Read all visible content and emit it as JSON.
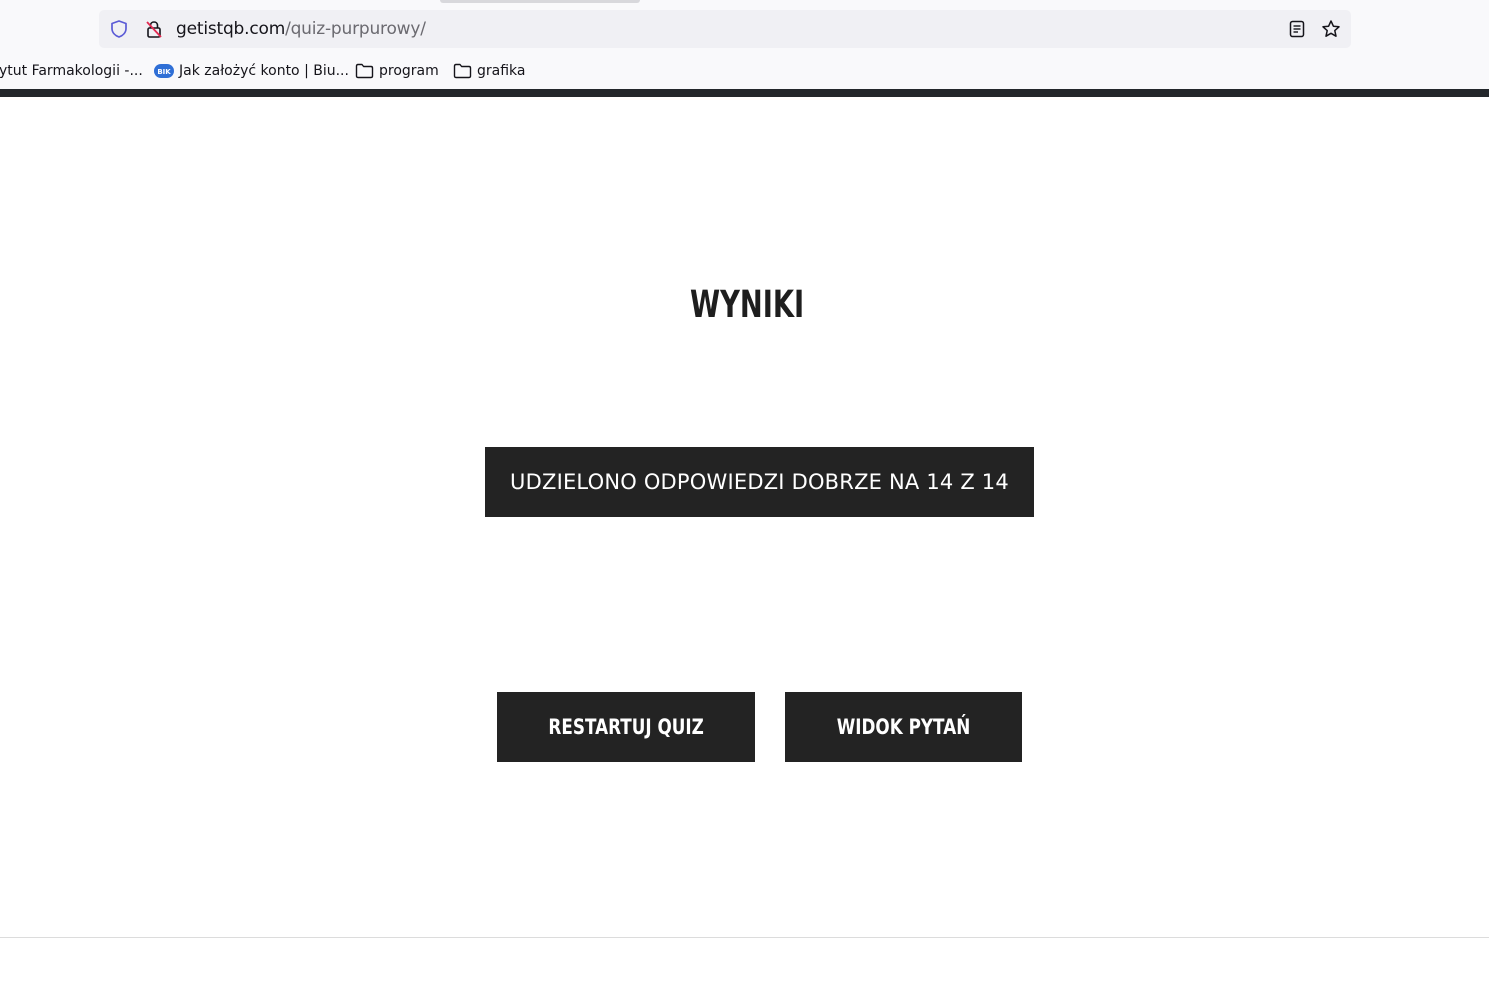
{
  "browser": {
    "url_domain": "getistqb.com",
    "url_path": "/quiz-purpurowy/",
    "bookmarks": [
      {
        "label": "ytut Farmakologii -...",
        "icon": "none"
      },
      {
        "label": "Jak założyć konto | Biu...",
        "icon": "bik-logo-icon",
        "icon_text": "BIK"
      },
      {
        "label": "program",
        "icon": "folder-icon"
      },
      {
        "label": "grafika",
        "icon": "folder-icon"
      }
    ]
  },
  "page": {
    "title": "WYNIKI",
    "score_text": "UDZIELONO ODPOWIEDZI DOBRZE NA 14 Z 14",
    "restart_label": "RESTARTUJ QUIZ",
    "view_label": "WIDOK PYTAŃ"
  },
  "colors": {
    "button_bg": "#232323",
    "button_text": "#ffffff",
    "heading": "#1e1e1e",
    "header_strip": "#23272b"
  }
}
